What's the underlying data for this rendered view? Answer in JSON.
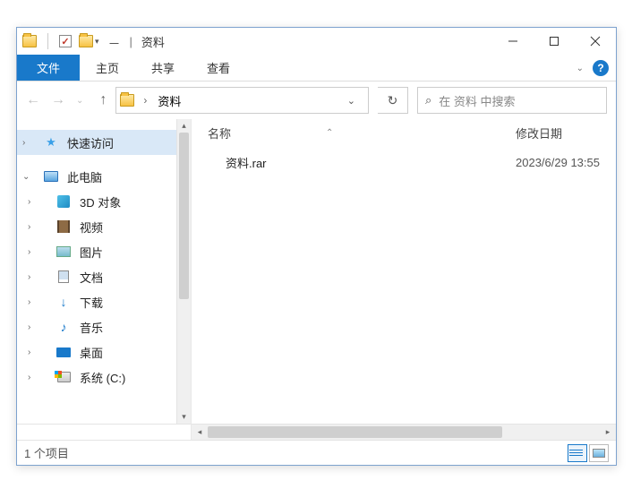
{
  "titlebar": {
    "separator": "|",
    "title": "资料"
  },
  "ribbon": {
    "file": "文件",
    "home": "主页",
    "share": "共享",
    "view": "查看"
  },
  "nav": {
    "address": "资料",
    "search_placeholder": "在 资料 中搜索"
  },
  "sidebar": {
    "quick_access": "快速访问",
    "this_pc": "此电脑",
    "items": [
      {
        "label": "3D 对象"
      },
      {
        "label": "视频"
      },
      {
        "label": "图片"
      },
      {
        "label": "文档"
      },
      {
        "label": "下载"
      },
      {
        "label": "音乐"
      },
      {
        "label": "桌面"
      },
      {
        "label": "系统 (C:)"
      }
    ]
  },
  "columns": {
    "name": "名称",
    "date": "修改日期"
  },
  "files": [
    {
      "name": "资料.rar",
      "date": "2023/6/29 13:55"
    }
  ],
  "status": {
    "count": "1 个项目"
  }
}
